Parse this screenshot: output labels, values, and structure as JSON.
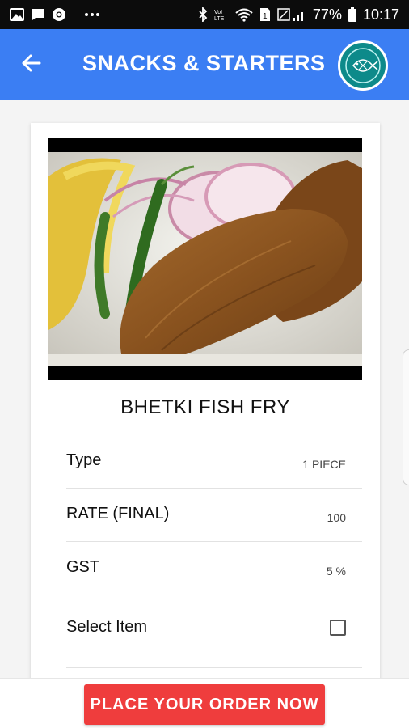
{
  "status_bar": {
    "battery_text": "77%",
    "time": "10:17",
    "icons": [
      "image-icon",
      "message-icon",
      "chrome-icon",
      "more-dots-icon",
      "bluetooth-icon",
      "volte-icon",
      "wifi-icon",
      "sim-icon",
      "signal-icon",
      "battery-icon"
    ]
  },
  "app_bar": {
    "title": "SNACKS & STARTERS",
    "back_icon": "arrow-back-icon",
    "logo_icon": "fish-logo-icon",
    "background_color": "#3b7ef3"
  },
  "item": {
    "image_description_icon": "fish-fry-photo",
    "name": "BHETKI FISH FRY",
    "rows": [
      {
        "label": "Type",
        "value": "1 PIECE"
      },
      {
        "label": "RATE (FINAL)",
        "value": "100"
      },
      {
        "label": "GST",
        "value": "5 %"
      },
      {
        "label": "Select Item",
        "checked": false
      }
    ]
  },
  "order_button": {
    "label": "PLACE YOUR ORDER NOW",
    "color": "#ef3d3d"
  }
}
